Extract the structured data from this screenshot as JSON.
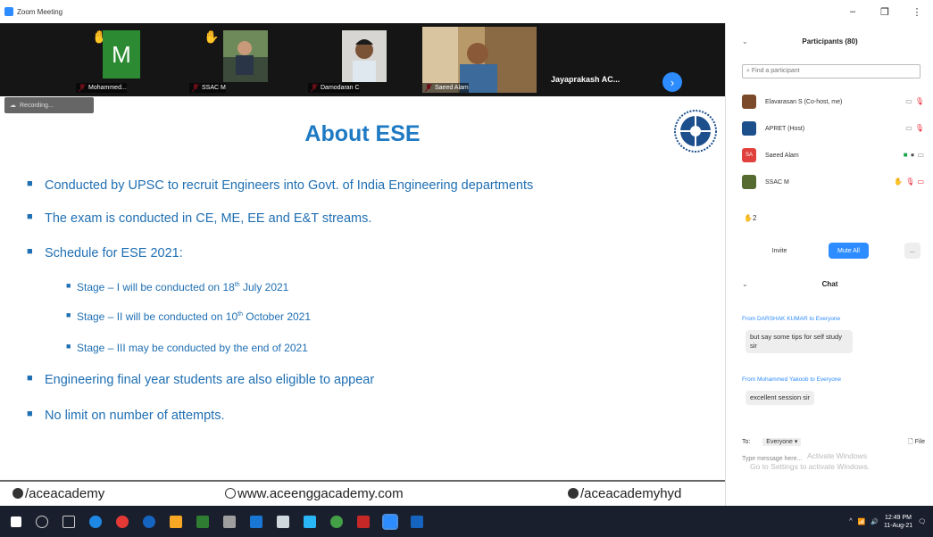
{
  "window": {
    "title": "Zoom Meeting",
    "buttons": [
      "–",
      "❐",
      "⋮"
    ]
  },
  "videos": [
    {
      "name": "Mohammed...",
      "raised_hand": true,
      "initial": "M"
    },
    {
      "name": "SSAC M",
      "raised_hand": true
    },
    {
      "name": "Damodaran C",
      "raised_hand": false
    },
    {
      "name": "Saeed Alam",
      "raised_hand": false
    }
  ],
  "active_speaker": "Jayaprakash AC...",
  "recording_label": "Recording...",
  "slide": {
    "title": "About ESE",
    "bullets": [
      "Conducted by UPSC to recruit Engineers into Govt. of India Engineering departments",
      "The exam is conducted in CE, ME, EE and E&T streams.",
      "Schedule for ESE 2021:",
      "Engineering final year students are also eligible to appear",
      "No limit on number of attempts."
    ],
    "sub_bullets": [
      {
        "before": "Stage – I will be conducted on 18",
        "sup": "th",
        "after": " July 2021"
      },
      {
        "before": "Stage – II will be conducted on 10",
        "sup": "th",
        "after": " October 2021"
      },
      {
        "before": "Stage – III may be conducted  by the end of 2021",
        "sup": "",
        "after": ""
      }
    ],
    "footer": {
      "facebook": "/aceacademy",
      "website": "www.aceenggacademy.com",
      "instagram": "/aceacademyhyd"
    }
  },
  "participants_panel": {
    "title": "Participants (80)",
    "search_placeholder": "Find a participant",
    "participants": [
      {
        "name": "Elavarasan S (Co-host, me)",
        "avatar": "photo",
        "color": "#7a4a2a"
      },
      {
        "name": "APRET (Host)",
        "avatar": "logo",
        "color": "#1d4f8c"
      },
      {
        "name": "Saeed Alam",
        "avatar": "SA",
        "color": "#e0413c"
      },
      {
        "name": "SSAC M",
        "avatar": "photo",
        "color": "#556b2f"
      }
    ],
    "raised_hand_count": "2",
    "invite_label": "Invite",
    "mute_all_label": "Mute All",
    "more_label": "..."
  },
  "chat": {
    "title": "Chat",
    "messages": [
      {
        "from": "From DARSHAK KUMAR to Everyone",
        "text": "but say some tips for self study sir"
      },
      {
        "from": "From Mohammed Yakoob to Everyone",
        "text": "excellent session sir"
      }
    ],
    "to_label": "To:",
    "to_value": "Everyone",
    "file_label": "File",
    "input_placeholder": "Type message here..."
  },
  "activation": {
    "line1": "Activate Windows",
    "line2": "Go to Settings to activate Windows."
  },
  "taskbar": {
    "time": "12:49 PM",
    "date": "11-Aug-21"
  },
  "colors": {
    "zoom_blue": "#2d8cff",
    "slide_blue": "#1f6fb3",
    "taskbar": "#1a1f2e"
  }
}
